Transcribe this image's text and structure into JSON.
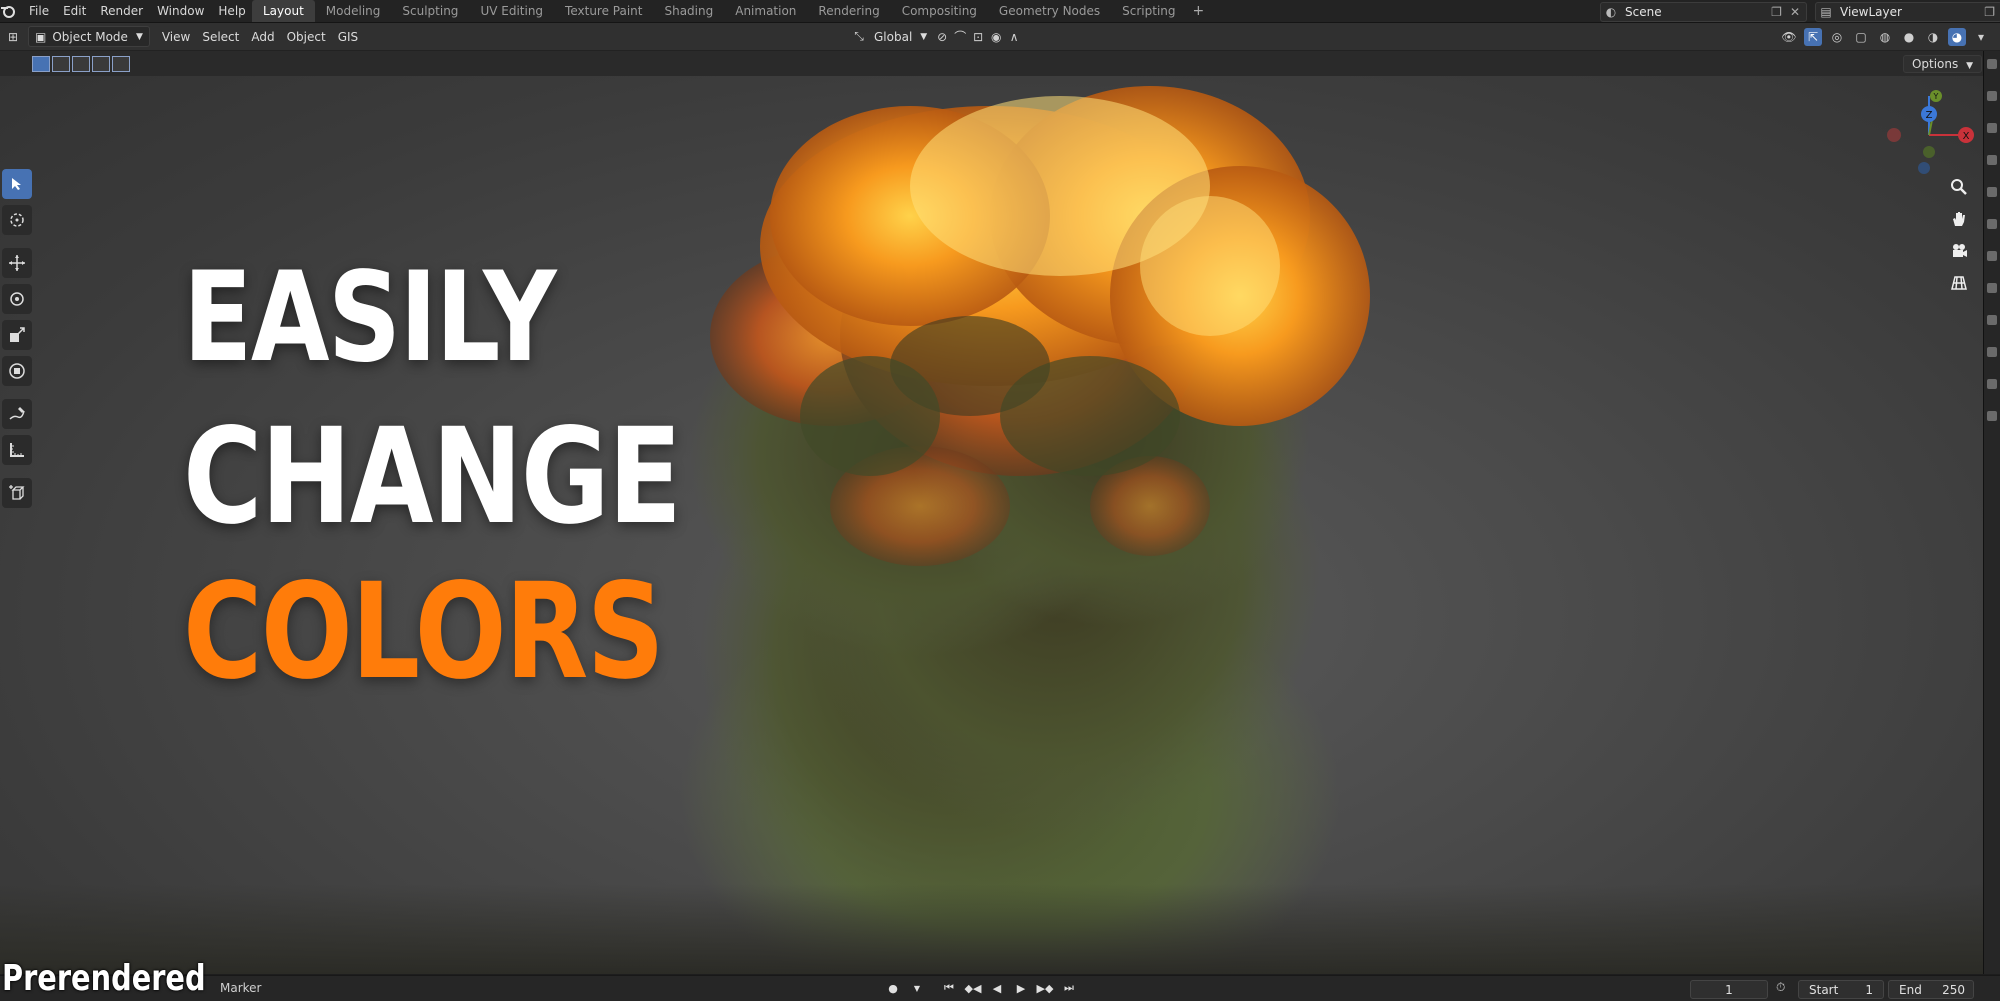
{
  "topbar": {
    "menu": [
      "File",
      "Edit",
      "Render",
      "Window",
      "Help"
    ],
    "workspaces": [
      "Layout",
      "Modeling",
      "Sculpting",
      "UV Editing",
      "Texture Paint",
      "Shading",
      "Animation",
      "Rendering",
      "Compositing",
      "Geometry Nodes",
      "Scripting"
    ],
    "active_workspace": "Layout",
    "add_tab": "+",
    "scene": "Scene",
    "view_layer": "ViewLayer"
  },
  "header": {
    "mode": "Object Mode",
    "menu": [
      "View",
      "Select",
      "Add",
      "Object",
      "GIS"
    ],
    "orientation": "Global"
  },
  "viewport": {
    "options": "Options",
    "headline": [
      "EASILY",
      "CHANGE",
      "COLORS"
    ],
    "watermark": "Prerendered",
    "gizmo": {
      "y": "Y",
      "z": "Z",
      "x": "X"
    }
  },
  "timeline": {
    "marker": "Marker",
    "current_frame": "1",
    "start_label": "Start",
    "start": "1",
    "end_label": "End",
    "end": "250"
  },
  "colors": {
    "accent": "#4772b3",
    "headline_orange": "#ff7c0a"
  }
}
